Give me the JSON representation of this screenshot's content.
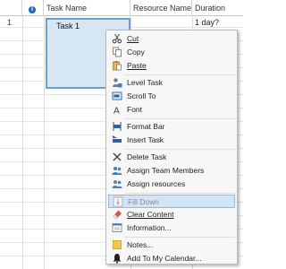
{
  "columns": {
    "info_icon": "i",
    "task_name": "Task Name",
    "resource_names": "Resource Names",
    "duration": "Duration"
  },
  "rows": [
    {
      "number": "1",
      "task_name": "Task 1",
      "duration": "1 day?"
    }
  ],
  "menu": {
    "items": [
      {
        "label": "Cut",
        "icon": "scissors-icon"
      },
      {
        "label": "Copy",
        "icon": "copy-icon"
      },
      {
        "label": "Paste",
        "icon": "paste-icon"
      },
      {
        "label": "Level Task",
        "icon": "level-task-icon"
      },
      {
        "label": "Scroll To",
        "icon": "scroll-to-icon"
      },
      {
        "label": "Font",
        "icon": "font-icon"
      },
      {
        "label": "Format Bar",
        "icon": "format-bar-icon"
      },
      {
        "label": "Insert Task",
        "icon": "insert-task-icon"
      },
      {
        "label": "Delete Task",
        "icon": "delete-x-icon"
      },
      {
        "label": "Assign Team Members",
        "icon": "team-members-icon"
      },
      {
        "label": "Assign resources",
        "icon": "assign-resources-icon"
      },
      {
        "label": "Fill Down",
        "icon": "fill-down-icon",
        "state": "disabled-highlighted"
      },
      {
        "label": "Clear Content",
        "icon": "eraser-icon"
      },
      {
        "label": "Information...",
        "icon": "information-icon"
      },
      {
        "label": "Notes...",
        "icon": "notes-icon"
      },
      {
        "label": "Add To My Calendar...",
        "icon": "bell-icon"
      }
    ]
  }
}
